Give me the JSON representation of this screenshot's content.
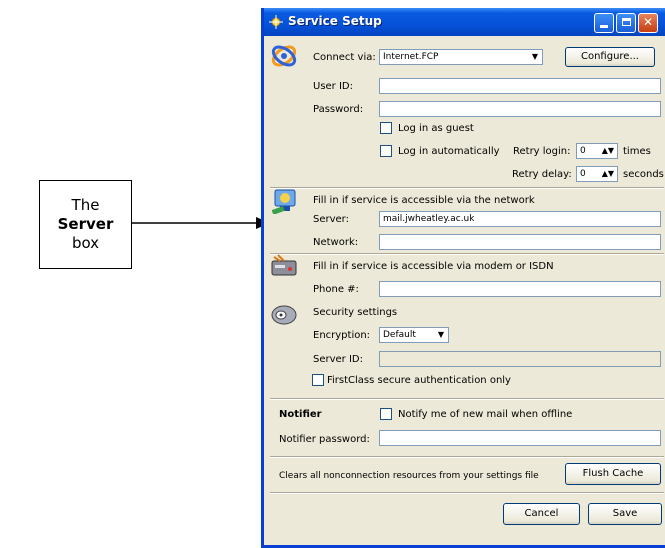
{
  "callout": {
    "line1": "The",
    "line2": "Server",
    "line3": "box"
  },
  "window": {
    "title": "Service Setup"
  },
  "connection": {
    "connect_label": "Connect via:",
    "connect_value": "Internet.FCP",
    "configure_label": "Configure...",
    "userid_label": "User ID:",
    "userid_value": "",
    "password_label": "Password:",
    "password_value": "",
    "guest_label": "Log in as guest",
    "auto_label": "Log in automatically",
    "retry_login_label": "Retry login:",
    "retry_login_value": "0",
    "retry_login_unit": "times",
    "retry_delay_label": "Retry delay:",
    "retry_delay_value": "0",
    "retry_delay_unit": "seconds"
  },
  "network": {
    "heading": "Fill in if service is accessible via the network",
    "server_label": "Server:",
    "server_value": "mail.jwheatley.ac.uk",
    "network_label": "Network:",
    "network_value": ""
  },
  "modem": {
    "heading": "Fill in if service is accessible via modem or ISDN",
    "phone_label": "Phone #:",
    "phone_value": ""
  },
  "security": {
    "heading": "Security settings",
    "encryption_label": "Encryption:",
    "encryption_value": "Default",
    "serverid_label": "Server ID:",
    "serverid_value": "",
    "secure_auth_label": "FirstClass secure authentication only"
  },
  "notifier": {
    "heading": "Notifier",
    "notify_label": "Notify me of new mail when offline",
    "password_label": "Notifier password:",
    "password_value": ""
  },
  "cache": {
    "text": "Clears all nonconnection resources from your settings file",
    "flush_label": "Flush Cache"
  },
  "footer": {
    "cancel_label": "Cancel",
    "save_label": "Save"
  }
}
